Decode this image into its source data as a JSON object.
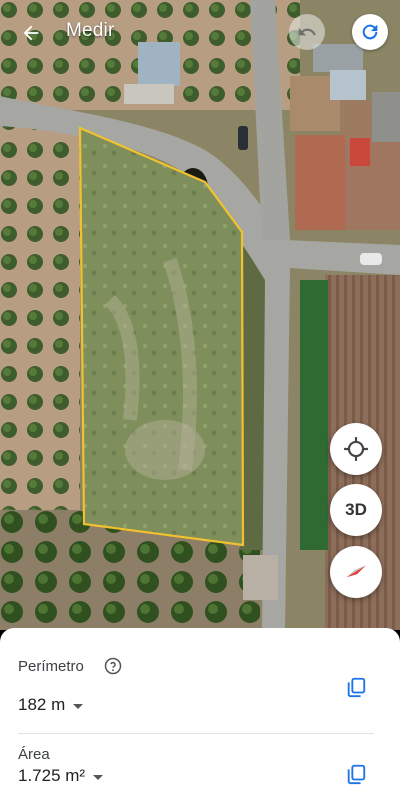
{
  "header": {
    "title": "Medir",
    "back_icon": "arrow-back-icon",
    "undo_icon": "undo-icon",
    "redo_icon": "redo-icon"
  },
  "map_controls": {
    "location_icon": "crosshair-location-icon",
    "view_3d_label": "3D",
    "compass_icon": "compass-icon"
  },
  "measurements": {
    "perimeter": {
      "label": "Perímetro",
      "value": "182 m"
    },
    "area": {
      "label": "Área",
      "value": "1.725 m²"
    },
    "help_icon": "help-circle-icon",
    "copy_icon": "copy-icon"
  },
  "colors": {
    "polygon_outline": "#f2c12e",
    "accent_blue": "#1a73e8",
    "compass_red": "#e53935"
  }
}
